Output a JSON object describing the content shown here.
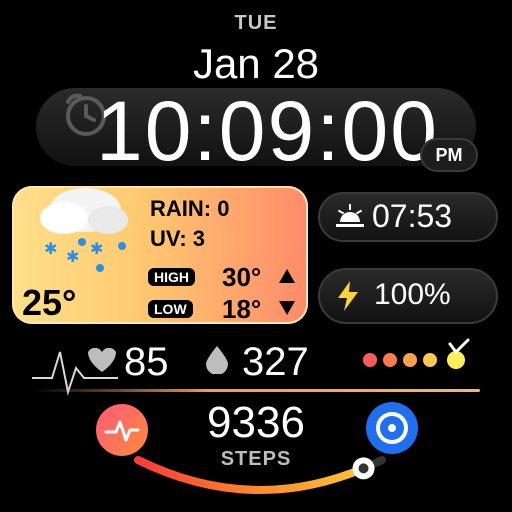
{
  "header": {
    "day": "TUE",
    "date": "Jan 28"
  },
  "time": {
    "value": "10:09:00",
    "ampm": "PM"
  },
  "weather": {
    "rain_label": "RAIN: 0",
    "uv_label": "UV: 3",
    "high_label": "HIGH",
    "low_label": "LOW",
    "high_temp": "30°",
    "low_temp": "18°",
    "current_temp": "25°"
  },
  "right_panels": {
    "sunrise_time": "07:53",
    "battery": "100%"
  },
  "stats": {
    "heart_rate": "85",
    "water": "327",
    "steps": "9336",
    "steps_label": "STEPS"
  },
  "indicators": {
    "dot_colors": [
      "#ff5a5a",
      "#ff7a4a",
      "#ffa24a",
      "#ffc84a",
      "#fff05a"
    ],
    "progress_fraction": 0.92
  },
  "icons": {
    "alarm": "alarm-clock-icon",
    "cloud": "rain-snow-cloud-icon",
    "sunrise": "sunrise-icon",
    "bolt": "lightning-bolt-icon",
    "heart": "heart-icon",
    "drop": "water-drop-icon",
    "activity": "activity-icon",
    "bixby": "bixby-icon"
  },
  "colors": {
    "weather_start": "#ffe08a",
    "weather_end": "#ff8a6a",
    "accent_blue": "#1f6ff0",
    "activity_pink": "#ff5a7a"
  }
}
